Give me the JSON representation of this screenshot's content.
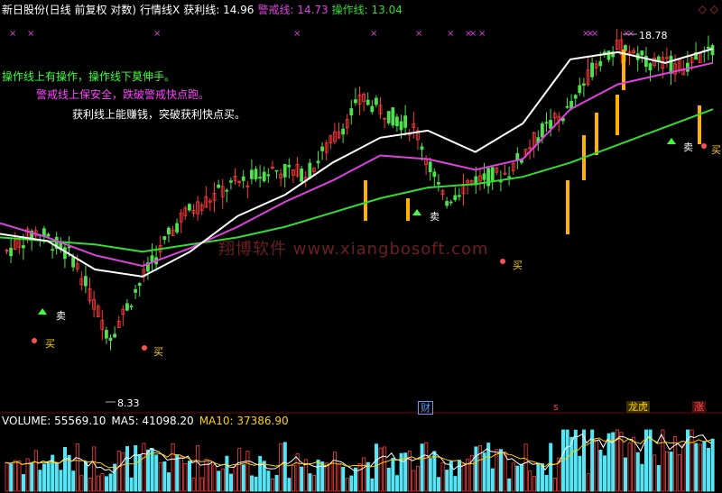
{
  "header": {
    "stock": "新日股份(日线 前复权 对数)",
    "indicator": "行情线X",
    "profit_label": "获利线: 14.96",
    "alert_label": "警戒线: 14.73",
    "op_label": "操作线: 13.04"
  },
  "notes": {
    "line1": "操作线上有操作，操作线下莫伸手。",
    "line2": "警戒线上保安全，跌破警戒快点跑。",
    "line3": "获利线上能赚钱，突破获利快点买。"
  },
  "annotations": {
    "high_label": "18.78",
    "low_label": "8.33",
    "sell": "卖",
    "buy": "买"
  },
  "watermark": "翔博软件 www.xiangbosoft.com",
  "badges": {
    "cai": "财",
    "s": "s",
    "longhu": "龙虎",
    "zhang": "涨"
  },
  "volume": {
    "label": "VOLUME: 55569.10",
    "ma5": "MA5: 41098.20",
    "ma10": "MA10: 37386.90"
  },
  "colors": {
    "up": "#ff3b3b",
    "down": "#4ee04e",
    "profit": "#ffffff",
    "alert": "#e040e0",
    "op": "#33dd33",
    "signal_bar": "#ffb000",
    "vol_up": "#ff4040",
    "vol_down": "#55e5f5"
  },
  "chart_data": {
    "type": "candlestick",
    "price_range": [
      8.33,
      18.78
    ],
    "profit_line": [
      13.1,
      12.9,
      12.1,
      11.9,
      12.6,
      13.6,
      14.2,
      15.1,
      15.8,
      16.0,
      15.4,
      16.2,
      18.0,
      18.2,
      17.9,
      18.3
    ],
    "alert_line": [
      13.4,
      13.0,
      12.5,
      12.2,
      12.7,
      13.3,
      14.0,
      14.6,
      15.3,
      15.2,
      14.9,
      15.2,
      16.6,
      17.3,
      17.6,
      17.9
    ],
    "op_line": [
      13.0,
      12.9,
      12.8,
      12.6,
      12.8,
      13.0,
      13.3,
      13.7,
      14.1,
      14.4,
      14.5,
      14.7,
      15.1,
      15.6,
      16.1,
      16.6
    ]
  }
}
